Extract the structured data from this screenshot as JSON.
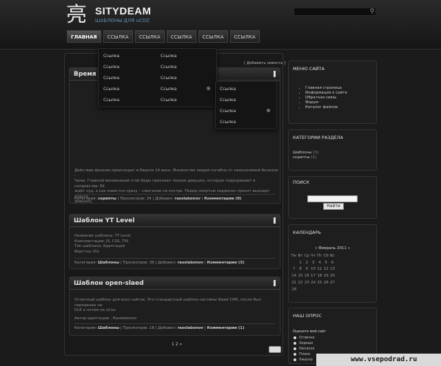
{
  "site": {
    "logo_glyph": "亮",
    "title": "SITYDEAM",
    "subtitle": "ШАБЛОНЫ ДЛЯ uCOZ",
    "search_icon": "magnifier-icon"
  },
  "nav": [
    "ГЛАВНАЯ",
    "ССЫЛКА",
    "ССЫЛКА",
    "ССЫЛКА",
    "ССЫЛКА",
    "ССЫЛКА"
  ],
  "content": {
    "add_news": "[ Добавить новость ]",
    "pager": "1 2 »"
  },
  "dropdown": {
    "col1": [
      "Ссылка",
      "Ссылка",
      "Ссылка",
      "Ссылка",
      "Ссылка"
    ],
    "col2": [
      "Ссылка",
      "Ссылка",
      "Ссылка",
      "Ссылка",
      "Ссылка"
    ],
    "submenu": [
      "Ссылка",
      "Ссылка",
      "Ссылка",
      "Ссылка"
    ]
  },
  "posts": [
    {
      "title": "Время ве",
      "body": [
        "Действие фильма происходит в Европе 14 века. Множество людей погибло от неизлечимой болезни –",
        "Чумы. Главной виновницей этой беды признают милую девушку, которую подозревают в колдовстве. Её",
        "ждёт суд, а как известно сразу – сжигание на костре. Перед смертью кардинал просит выходит спасти",
        "девушку."
      ],
      "footer": {
        "cat_label": "Категория:",
        "cat": "скрипты",
        "views_label": "Просмотров:",
        "views": "34",
        "added_label": "Добавил:",
        "author": "rasslabonov",
        "comments": "Комментарии (0)"
      }
    },
    {
      "title": "Шаблон YT Level",
      "body": [
        "Название шаблона: YT Level",
        "Комплектация: JS, CSS, TPL",
        "Тип шаблона: Адаптация",
        "Верстка: Div"
      ],
      "footer": {
        "cat_label": "Категория:",
        "cat": "Шаблоны",
        "views_label": "Просмотров:",
        "views": "36",
        "added_label": "Добавил:",
        "author": "rasslabonov",
        "comments": "Комментарии (3)"
      }
    },
    {
      "title": "Шаблон open-slaed",
      "body": [
        "Отличный шаблон для всех сайтов. Это стандартный шаблон системы Slaed CMS, после был переделан на",
        "DLE а потом на uCoz.",
        "",
        "Автор адаптации : Rasslabonov"
      ],
      "footer": {
        "cat_label": "Категория:",
        "cat": "Шаблоны",
        "views_label": "Просмотров:",
        "views": "18",
        "added_label": "Добавил:",
        "author": "rasslabonov",
        "comments": "Комментарии (1)"
      }
    }
  ],
  "sidebar": {
    "menu": {
      "title": "МЕНЮ САЙТА",
      "items": [
        "Главная страница",
        "Информация о сайте",
        "Обратная связь",
        "Форум",
        "Каталог файлов"
      ]
    },
    "categories": {
      "title": "КАТЕГОРИИ РАЗДЕЛА",
      "items": [
        {
          "name": "Шаблоны",
          "count": "[3]"
        },
        {
          "name": "скрипты",
          "count": "[1]"
        }
      ]
    },
    "search": {
      "title": "ПОИСК",
      "button": "Найти"
    },
    "calendar": {
      "title": "КАЛЕНДАРЬ",
      "month": "« Февраль 2011 »",
      "weekdays": [
        "Пн",
        "Вт",
        "Ср",
        "Чт",
        "Пт",
        "Сб",
        "Вс"
      ],
      "weeks": [
        [
          "",
          "1",
          "2",
          "3",
          "4",
          "5",
          "6"
        ],
        [
          "7",
          "8",
          "9",
          "10",
          "11",
          "12",
          "13"
        ],
        [
          "14",
          "15",
          "16",
          "17",
          "18",
          "19",
          "20"
        ],
        [
          "21",
          "22",
          "23",
          "24",
          "25",
          "26",
          "27"
        ],
        [
          "28",
          "",
          "",
          "",
          "",
          "",
          ""
        ]
      ]
    },
    "poll": {
      "title": "НАШ ОПРОС",
      "question": "Оцените мой сайт",
      "options": [
        "Отлично",
        "Хорошо",
        "Неплохо",
        "Плохо",
        "Ужасно"
      ]
    }
  },
  "watermark": "www.vsepodrad.ru"
}
